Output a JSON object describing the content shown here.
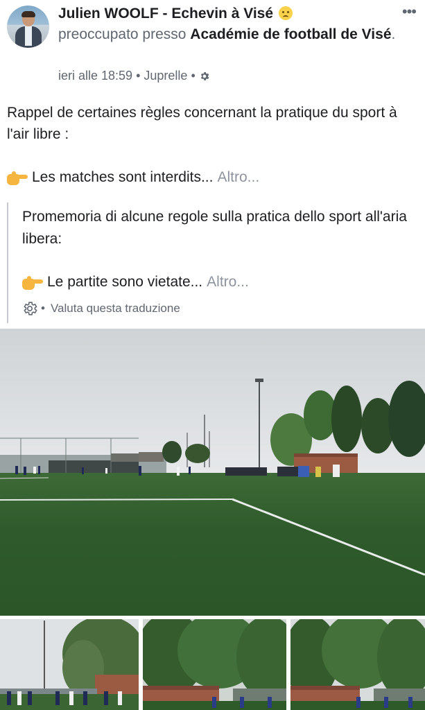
{
  "post": {
    "author": "Julien WOOLF - Echevin à Visé",
    "feeling_prefix": "preoccupato presso ",
    "location": "Académie de football de Visé",
    "location_suffix": ".",
    "time": "ieri alle 18:59",
    "place": "Juprelle",
    "text_line1": "Rappel de certaines règles concernant la pratique du sport à l'air libre :",
    "text_line2": "Les matches sont interdits...",
    "more_label": "Altro..."
  },
  "translation": {
    "text_line1": "Promemoria di alcune regole sulla pratica dello sport all'aria libera:",
    "text_line2": "Le partite sono vietate...",
    "more_label": "Altro...",
    "rate_label": "Valuta questa traduzione"
  },
  "icons": {
    "more": "more-horizontal-icon",
    "privacy": "gear-icon",
    "feeling": "worried-face-emoji",
    "pointing": "pointing-right-hand-emoji"
  },
  "colors": {
    "primary_text": "#1c1e21",
    "secondary_text": "#606770",
    "link_more": "#8d949e",
    "pitch_green": "#3f6a3a"
  }
}
